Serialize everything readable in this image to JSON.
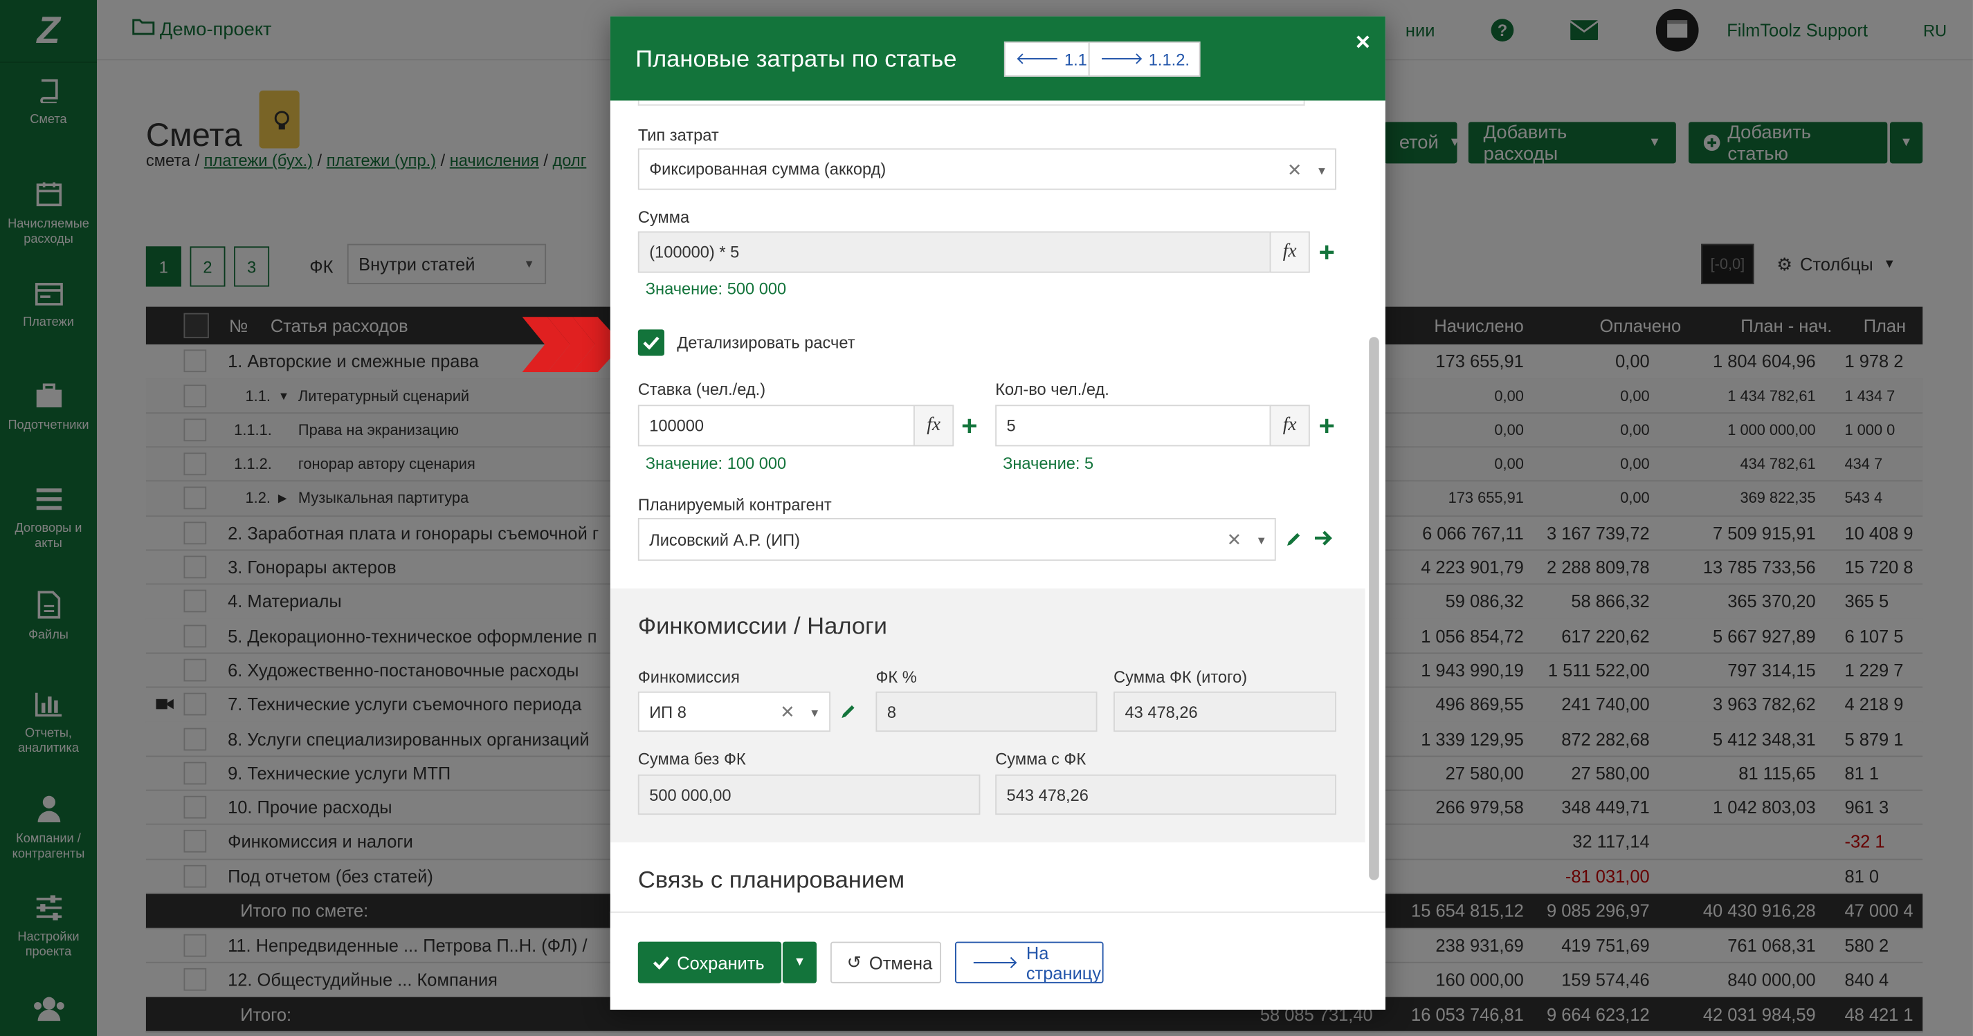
{
  "app": {
    "logo": "Z",
    "project": "Демо-проект",
    "support": "FilmToolz Support",
    "lang": "RU",
    "top_partial": "нии"
  },
  "sidebar": [
    {
      "label": "Смета",
      "icon": "book-icon"
    },
    {
      "label": "Начисляемые расходы",
      "icon": "calendar-icon"
    },
    {
      "label": "Платежи",
      "icon": "card-icon"
    },
    {
      "label": "Подотчетники",
      "icon": "briefcase-icon"
    },
    {
      "label": "Договоры и акты",
      "icon": "list-icon"
    },
    {
      "label": "Файлы",
      "icon": "file-icon"
    },
    {
      "label": "Отчеты, аналитика",
      "icon": "chart-icon"
    },
    {
      "label": "Компании / контрагенты",
      "icon": "person-icon"
    },
    {
      "label": "Настройки проекта",
      "icon": "sliders-icon"
    },
    {
      "label": "",
      "icon": "users-icon"
    }
  ],
  "page": {
    "title": "Смета",
    "crumbs": [
      "смета",
      "платежи (бух.)",
      "платежи (упр.)",
      "начисления",
      "долг"
    ],
    "pages": [
      "1",
      "2",
      "3"
    ],
    "fk_label": "ФК",
    "fk_select": "Внутри статей",
    "btn_partial": "етой",
    "btn_add_expenses": "Добавить расходы",
    "btn_add_article": "Добавить статью",
    "zero_badge": "[-0,0]",
    "columns_btn": "Столбцы"
  },
  "table": {
    "headers": {
      "num": "№",
      "article": "Статья расходов",
      "accrued": "Начислено",
      "paid": "Оплачено",
      "plan_acc": "План - нач.",
      "plan": "План"
    },
    "rows": [
      {
        "text": "1. Авторские и смежные права",
        "a": "173 655,91",
        "p": "0,00",
        "pn": "1 804 604,96",
        "pl": "1 978 2",
        "type": "main"
      },
      {
        "text": "1.1.",
        "extra": "Литературный сценарий",
        "a": "0,00",
        "p": "0,00",
        "pn": "1 434 782,61",
        "pl": "1 434 7",
        "type": "sub",
        "caret": "▼"
      },
      {
        "text": "1.1.1.",
        "extra": "Права на экранизацию",
        "a": "0,00",
        "p": "0,00",
        "pn": "1 000 000,00",
        "pl": "1 000 0",
        "type": "sub2"
      },
      {
        "text": "1.1.2.",
        "extra": "гонорар автору сценария",
        "a": "0,00",
        "p": "0,00",
        "pn": "434 782,61",
        "pl": "434 7",
        "type": "sub2"
      },
      {
        "text": "1.2.",
        "extra": "Музыкальная партитура",
        "a": "173 655,91",
        "p": "0,00",
        "pn": "369 822,35",
        "pl": "543 4",
        "type": "sub",
        "caret": "▶"
      },
      {
        "text": "2. Заработная плата и гонорары съемочной г",
        "a": "6 066 767,11",
        "p": "3 167 739,72",
        "pn": "7 509 915,91",
        "pl": "10 408 9",
        "type": "main"
      },
      {
        "text": "3. Гонорары актеров",
        "a": "4 223 901,79",
        "p": "2 288 809,78",
        "pn": "13 785 733,56",
        "pl": "15 720 8",
        "type": "main"
      },
      {
        "text": "4. Материалы",
        "a": "59 086,32",
        "p": "58 866,32",
        "pn": "365 370,20",
        "pl": "365 5",
        "type": "main"
      },
      {
        "text": "5. Декорационно-техническое оформление п",
        "a": "1 056 854,72",
        "p": "617 220,62",
        "pn": "5 667 927,89",
        "pl": "6 107 5",
        "type": "main"
      },
      {
        "text": "6. Художественно-постановочные расходы",
        "a": "1 943 990,19",
        "p": "1 511 522,00",
        "pn": "797 314,15",
        "pl": "1 229 7",
        "type": "main"
      },
      {
        "text": "7. Технические услуги съемочного периода",
        "a": "496 869,55",
        "p": "241 740,00",
        "pn": "3 963 782,62",
        "pl": "4 218 9",
        "type": "main",
        "cam": true
      },
      {
        "text": "8. Услуги специализированных организаций",
        "a": "1 339 129,95",
        "p": "872 282,68",
        "pn": "5 412 348,31",
        "pl": "5 879 1",
        "type": "main"
      },
      {
        "text": "9. Технические услуги МТП",
        "a": "27 580,00",
        "p": "27 580,00",
        "pn": "81 115,65",
        "pl": "81 1",
        "type": "main"
      },
      {
        "text": "10. Прочие расходы",
        "a": "266 979,58",
        "p": "348 449,71",
        "pn": "1 042 803,03",
        "pl": "961 3",
        "type": "main"
      },
      {
        "text": "Финкомиссия и налоги",
        "a": "",
        "p": "32 117,14",
        "pn": "",
        "pl": "-32 1",
        "type": "main",
        "plred": true
      },
      {
        "text": "Под отчетом (без статей)",
        "a": "",
        "p": "-81 031,00",
        "pn": "",
        "pl": "81 0",
        "type": "main",
        "pred": true
      },
      {
        "text": "Итого по смете:",
        "a": "15 654 815,12",
        "p": "9 085 296,97",
        "pn": "40 430 916,28",
        "pl": "47 000 4",
        "type": "total"
      },
      {
        "text": "11. Непредвиденные ... Петрова П..Н. (ФЛ) /",
        "a": "238 931,69",
        "p": "419 751,69",
        "pn": "761 068,31",
        "pl": "580 2",
        "type": "main"
      },
      {
        "text": "12. Общестудийные ... Компания",
        "a": "160 000,00",
        "p": "159 574,46",
        "pn": "840 000,00",
        "pl": "840 4",
        "type": "main"
      },
      {
        "text": "Итого:",
        "t": "58 085 731,40",
        "a": "16 053 746,81",
        "p": "9 664 623,12",
        "pn": "42 031 984,59",
        "pl": "48 421 1",
        "type": "total"
      }
    ]
  },
  "modal": {
    "title": "Плановые затраты по статье",
    "nav_prev": "1.1.",
    "nav_next": "1.1.2.",
    "close": "×",
    "cost_type_label": "Тип затрат",
    "cost_type_value": "Фиксированная сумма (аккорд)",
    "sum_label": "Сумма",
    "sum_value": "(100000) * 5",
    "sum_result": "Значение: 500 000",
    "detail_label": "Детализировать расчет",
    "rate_label": "Ставка (чел./ед.)",
    "rate_value": "100000",
    "rate_result": "Значение: 100 000",
    "qty_label": "Кол-во чел./ед.",
    "qty_value": "5",
    "qty_result": "Значение: 5",
    "counterparty_label": "Планируемый контрагент",
    "counterparty_value": "Лисовский А.Р. (ИП)",
    "fin_section": "Финкомиссии / Налоги",
    "fin_label": "Финкомиссия",
    "fin_value": "ИП 8",
    "fk_pct_label": "ФК %",
    "fk_pct_value": "8",
    "fk_total_label": "Сумма ФК (итого)",
    "fk_total_value": "43 478,26",
    "sum_wo_label": "Сумма без ФК",
    "sum_wo_value": "500 000,00",
    "sum_w_label": "Сумма с ФК",
    "sum_w_value": "543 478,26",
    "plan_section": "Связь с планированием",
    "fx": "fx",
    "save": "Сохранить",
    "cancel": "Отмена",
    "to_page": "На страницу"
  },
  "colors": {
    "brand": "#13743b",
    "value_green": "#13743b",
    "link_blue": "#2255aa",
    "arrow_red": "#e02020"
  }
}
